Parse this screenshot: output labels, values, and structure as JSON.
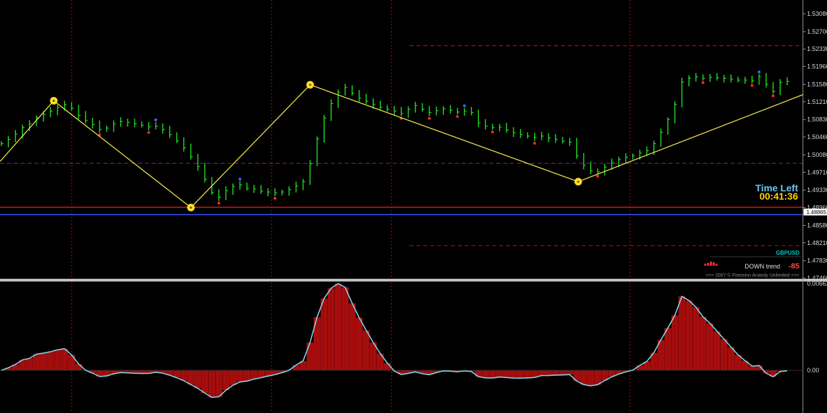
{
  "chart_data": [
    {
      "type": "bar",
      "description_symbol": "GBPUSD",
      "price_axis": {
        "labels": [
          "1.53080",
          "1.52700",
          "1.52330",
          "1.51960",
          "1.51580",
          "1.51210",
          "1.50830",
          "1.50460",
          "1.50080",
          "1.49710",
          "1.49330",
          "1.48960",
          "1.48580",
          "1.48210",
          "1.47830",
          "1.47460"
        ],
        "ylim": [
          1.4746,
          1.5308
        ]
      },
      "current_price_tag": "1.48865",
      "zigzag_pivots": [
        1.4994,
        1.5123,
        1.4896,
        1.5157,
        1.4951,
        1.5136
      ],
      "series": [
        {
          "key": "close",
          "values": [
            1.5032,
            1.5041,
            1.5052,
            1.5066,
            1.5074,
            1.5087,
            1.5094,
            1.5101,
            1.5109,
            1.5115,
            1.5107,
            1.5092,
            1.5081,
            1.5073,
            1.5062,
            1.5065,
            1.5074,
            1.5079,
            1.5077,
            1.5074,
            1.5071,
            1.5068,
            1.5069,
            1.5062,
            1.5051,
            1.5038,
            1.5023,
            1.5004,
            1.4983,
            1.4956,
            1.4928,
            1.4918,
            1.4932,
            1.4941,
            1.4944,
            1.4937,
            1.4935,
            1.4931,
            1.4929,
            1.4927,
            1.4929,
            1.4934,
            1.4942,
            1.4951,
            1.4989,
            1.5042,
            1.5086,
            1.5117,
            1.5141,
            1.5151,
            1.5139,
            1.5129,
            1.5122,
            1.5115,
            1.5109,
            1.5105,
            1.5101,
            1.5096,
            1.5105,
            1.5113,
            1.5105,
            1.5098,
            1.5102,
            1.5106,
            1.5103,
            1.5099,
            1.5101,
            1.5098,
            1.5076,
            1.5069,
            1.5066,
            1.5067,
            1.5061,
            1.5055,
            1.5051,
            1.5048,
            1.5045,
            1.5048,
            1.5044,
            1.5041,
            1.5037,
            1.5035,
            1.5006,
            1.4986,
            1.4974,
            1.4972,
            1.4982,
            1.4991,
            1.4998,
            1.5003,
            1.5006,
            1.5012,
            1.5017,
            1.5032,
            1.5056,
            1.5083,
            1.5115,
            1.5163,
            1.5171,
            1.5174,
            1.5171,
            1.5173,
            1.5172,
            1.5171,
            1.5169,
            1.5167,
            1.5167,
            1.5166,
            1.5174,
            1.5158,
            1.5143,
            1.5162,
            1.5164
          ]
        },
        {
          "key": "histogram",
          "range": [
            -0.0048,
            0.00662
          ],
          "zero_label": "0.00",
          "top_label": "0.00662"
        }
      ]
    }
  ],
  "panel": {
    "time_left_title": "Time Left",
    "time_left_value": "00:41:36",
    "symbol": "GBPUSD",
    "trend_label": "DOWN trend",
    "trend_value": "-85",
    "copyright": ">>>  2007 © Forexinn Anatoly Unlimited  <<<"
  },
  "colors": {
    "background": "#000000",
    "bar_up": "#22e022",
    "pivot_up": "#3a6bff",
    "pivot_down": "#ff2a2a",
    "zigzag": "#f0e24a",
    "zigzag_node": "#ffe022",
    "grid_vertical": "#c01010",
    "histogram_fill": "#cc1010",
    "signal_line": "#7fd8e8",
    "hline_red": "#d01818",
    "hline_blue": "#2f54ff",
    "separator": "#bfbfbf"
  },
  "icons": [
    "zigzag-node-icon",
    "pivot-dot-icon",
    "trend-bars-icon"
  ]
}
